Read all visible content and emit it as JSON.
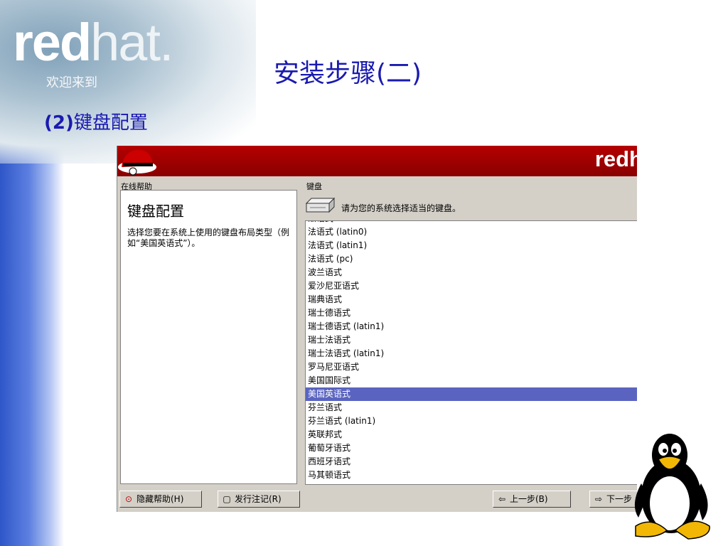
{
  "slide": {
    "brand_text_bold": "red",
    "brand_text_light": "hat.",
    "brand_welcome": "欢迎来到",
    "title": "安装步骤(二)",
    "subtitle_num": "(2)",
    "subtitle_text": "键盘配置"
  },
  "installer": {
    "header_brand": "redh",
    "help_group_label": "在线帮助",
    "help_heading": "键盘配置",
    "help_body": "选择您要在系统上使用的键盘布局类型（例如“美国英语式”）。",
    "keyboard_group_label": "键盘",
    "keyboard_prompt": "请为您的系统选择适当的键盘。",
    "keyboard_list": [
      "法语式",
      "法语式 (latin0)",
      "法语式 (latin1)",
      "法语式 (pc)",
      "波兰语式",
      "爱沙尼亚语式",
      "瑞典语式",
      "瑞士德语式",
      "瑞士德语式 (latin1)",
      "瑞士法语式",
      "瑞士法语式 (latin1)",
      "罗马尼亚语式",
      "美国国际式",
      "美国英语式",
      "芬兰语式",
      "芬兰语式 (latin1)",
      "英联邦式",
      "葡萄牙语式",
      "西班牙语式",
      "马其顿语式"
    ],
    "selected_item": "美国英语式",
    "buttons": {
      "hide_help": "隐藏帮助(H)",
      "release_notes": "发行注记(R)",
      "back": "上一步(B)",
      "next": "下一步"
    }
  },
  "colors": {
    "title_blue": "#1a1ab0",
    "header_red": "#b50000",
    "selection_blue": "#5a64c0",
    "installer_gray": "#d4d0c8"
  }
}
